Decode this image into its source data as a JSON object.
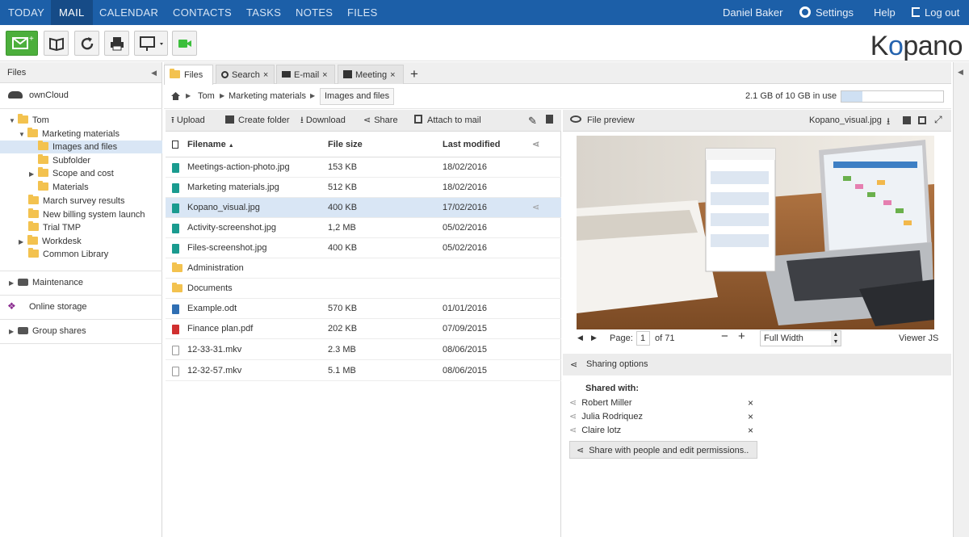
{
  "nav": {
    "items": [
      "TODAY",
      "MAIL",
      "CALENDAR",
      "CONTACTS",
      "TASKS",
      "NOTES",
      "FILES"
    ],
    "user": "Daniel Baker",
    "settings": "Settings",
    "help": "Help",
    "logout": "Log out"
  },
  "brand": {
    "logo_k": "K",
    "logo_o": "o",
    "logo_rest": "pano"
  },
  "left": {
    "header": "Files",
    "owncloud": "ownCloud",
    "tree": [
      "Tom",
      "Marketing materials",
      "Images and files",
      "Subfolder",
      "Scope and cost",
      "Materials",
      "March survey results",
      "New billing system launch",
      "Trial TMP",
      "Workdesk",
      "Common Library"
    ],
    "maintenance": "Maintenance",
    "online_storage": "Online storage",
    "group_shares": "Group shares"
  },
  "tabs": [
    "Files",
    "Search",
    "E-mail",
    "Meeting"
  ],
  "breadcrumb": {
    "items": [
      "Tom",
      "Marketing materials",
      "Images and files"
    ],
    "quota": "2.1 GB of 10 GB in use",
    "quota_fraction": 0.21
  },
  "filebar": {
    "upload": "Upload",
    "create": "Create folder",
    "download": "Download",
    "share": "Share",
    "attach": "Attach to mail"
  },
  "table": {
    "headers": [
      "Filename",
      "File size",
      "Last modified"
    ],
    "rows": [
      {
        "name": "Meetings-action-photo.jpg",
        "size": "153 KB",
        "date": "18/02/2016"
      },
      {
        "name": "Marketing materials.jpg",
        "size": "512 KB",
        "date": "18/02/2016"
      },
      {
        "name": "Kopano_visual.jpg",
        "size": "400 KB",
        "date": "17/02/2016"
      },
      {
        "name": "Activity-screenshot.jpg",
        "size": "1,2 MB",
        "date": "05/02/2016"
      },
      {
        "name": "Files-screenshot.jpg",
        "size": "400 KB",
        "date": "05/02/2016"
      },
      {
        "name": "Administration",
        "size": "",
        "date": ""
      },
      {
        "name": "Documents",
        "size": "",
        "date": ""
      },
      {
        "name": "Example.odt",
        "size": "570 KB",
        "date": "01/01/2016"
      },
      {
        "name": "Finance plan.pdf",
        "size": "202 KB",
        "date": "07/09/2015"
      },
      {
        "name": "12-33-31.mkv",
        "size": "2.3 MB",
        "date": "08/06/2015"
      },
      {
        "name": "12-32-57.mkv",
        "size": "5.1 MB",
        "date": "08/06/2015"
      }
    ]
  },
  "preview": {
    "title": "File preview",
    "filename": "Kopano_visual.jpg",
    "page_label": "Page:",
    "page_value": "1",
    "of_pages": "of 71",
    "zoom": "Full Width",
    "viewer": "Viewer JS"
  },
  "sharing": {
    "title": "Sharing options",
    "shared_with": "Shared with:",
    "people": [
      "Robert Miller",
      "Julia Rodriquez",
      "Claire lotz"
    ],
    "button": "Share with people and edit permissions.."
  },
  "colors": {
    "nav": "#1c5fa8",
    "accent_green": "#4caf3c",
    "selection": "#d9e6f5",
    "folder": "#f3c24f"
  }
}
